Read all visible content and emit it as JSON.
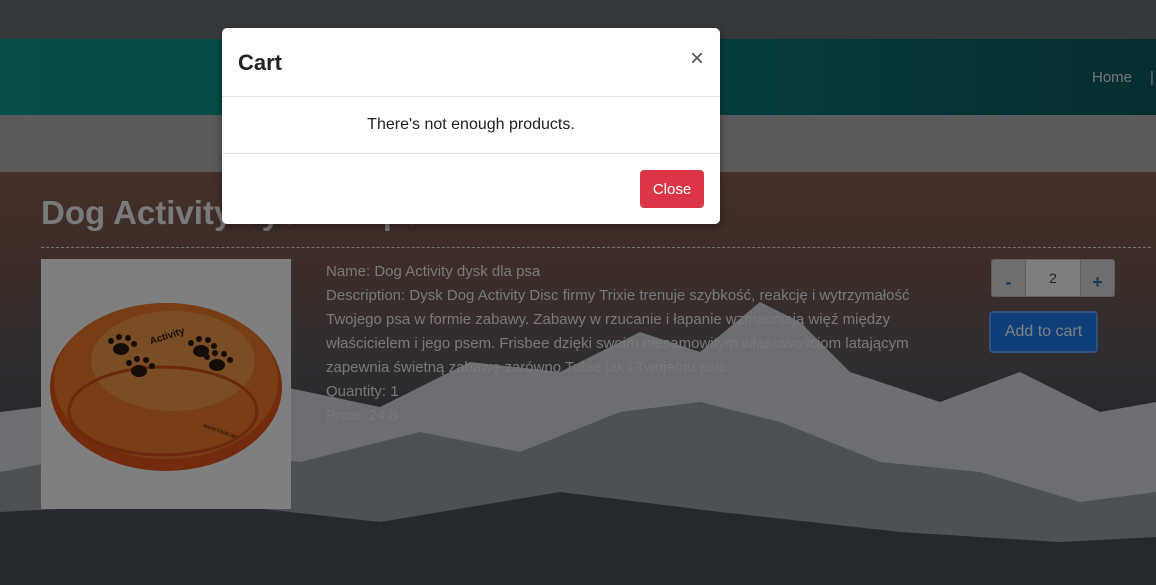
{
  "nav": {
    "links": [
      "Home",
      ""
    ]
  },
  "product": {
    "title": "Dog Activity dysk dla psa",
    "name_line": "Name: Dog Activity dysk dla psa",
    "description_line": "Description: Dysk Dog Activity Disc firmy Trixie trenuje szybkość, reakcję i wytrzymałość Twojego psa w formie zabawy. Zabawy w rzucanie i łapanie wzmacniają więź między właścicielem i jego psem. Frisbee dzięki swoim niesamowitym właściwościom latającym zapewnia świetną zabawę zarówno Tobie jak i Twojemu psu.",
    "quantity_line": "Quantity: 1",
    "price_line": "Price: 24.8",
    "image_brand": "Activity",
    "image_url_text": "www.trixie.de"
  },
  "cart_controls": {
    "minus_label": "-",
    "quantity_value": "2",
    "plus_label": "+",
    "add_label": "Add to cart"
  },
  "modal": {
    "title": "Cart",
    "close_symbol": "×",
    "message": "There's not enough products.",
    "close_label": "Close"
  },
  "colors": {
    "navbar": "#0e9b90",
    "close_button": "#dc3545",
    "add_button": "#1f7ef7"
  }
}
